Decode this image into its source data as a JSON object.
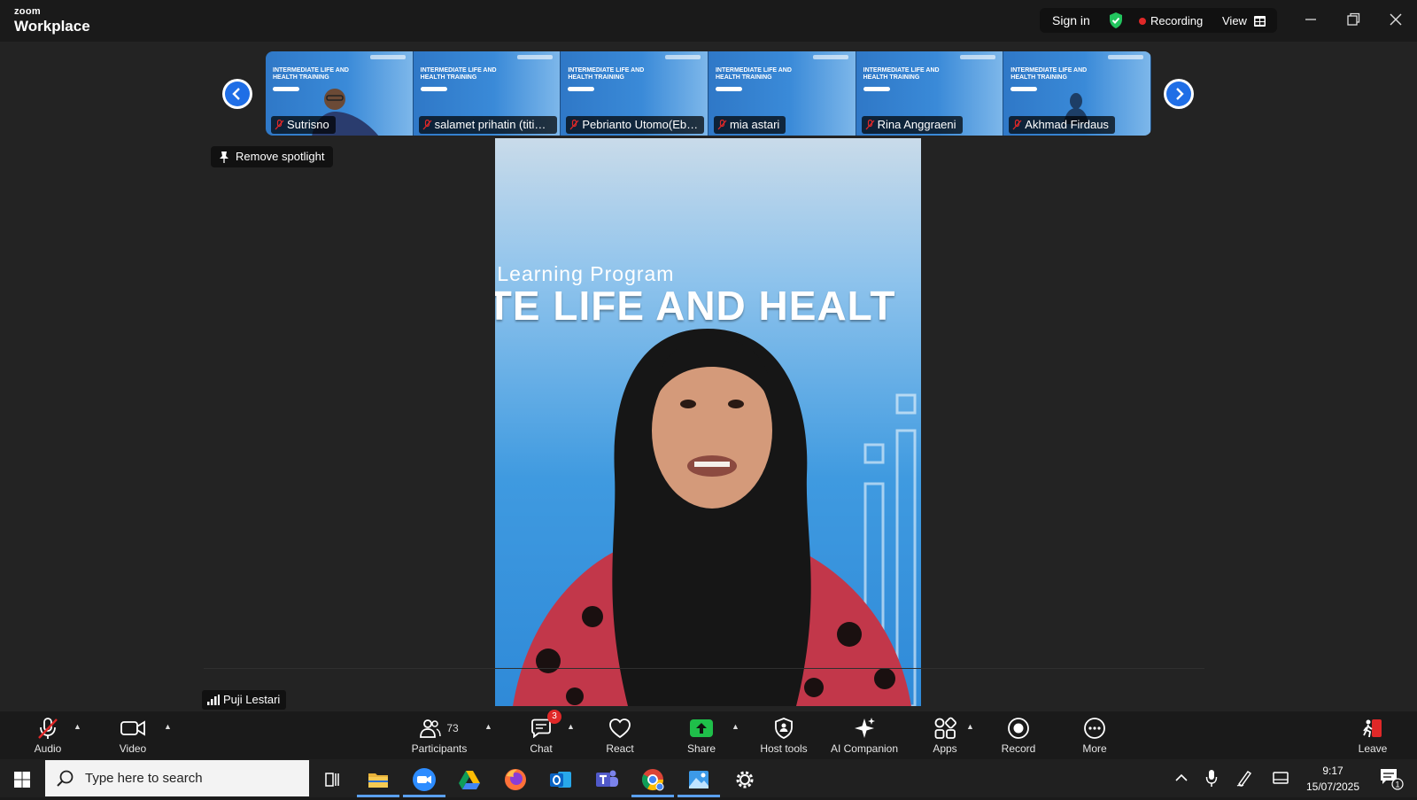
{
  "app": {
    "brand_small": "zoom",
    "brand_large": "Workplace"
  },
  "header": {
    "sign_in": "Sign in",
    "recording": "Recording",
    "view": "View"
  },
  "gallery": {
    "tiles": [
      {
        "name": "Sutrisno"
      },
      {
        "name": "salamet prihatin (titin ..."
      },
      {
        "name": "Pebrianto Utomo(Ebhy)"
      },
      {
        "name": "mia astari"
      },
      {
        "name": "Rina Anggraeni"
      },
      {
        "name": "Akhmad Firdaus"
      }
    ],
    "slide_title": "INTERMEDIATE LIFE AND HEALTH TRAINING"
  },
  "spotlight": {
    "remove_label": "Remove spotlight"
  },
  "speaker": {
    "name": "Puji Lestari",
    "bg_line1": "ate Learning Program",
    "bg_line2": "ATE LIFE AND HEALT"
  },
  "toolbar": {
    "audio": "Audio",
    "video": "Video",
    "participants": "Participants",
    "participants_count": "73",
    "chat": "Chat",
    "chat_badge": "3",
    "react": "React",
    "share": "Share",
    "host_tools": "Host tools",
    "ai_companion": "AI Companion",
    "apps": "Apps",
    "record": "Record",
    "more": "More",
    "leave": "Leave"
  },
  "taskbar": {
    "search_placeholder": "Type here to search",
    "time": "9:17",
    "date": "15/07/2025",
    "notification_count": "1"
  },
  "colors": {
    "accent_blue": "#1f6ee6",
    "record_red": "#e02828",
    "share_green": "#1fbf4a",
    "secure_green": "#22c55e"
  }
}
